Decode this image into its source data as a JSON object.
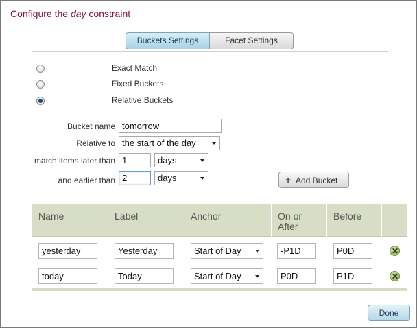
{
  "dialog": {
    "title_prefix": "Configure the ",
    "title_emph": "day",
    "title_suffix": " constraint"
  },
  "tabs": [
    {
      "label": "Buckets Settings",
      "active": true
    },
    {
      "label": "Facet Settings",
      "active": false
    }
  ],
  "match_options": [
    {
      "label": "Exact Match",
      "checked": false
    },
    {
      "label": "Fixed Buckets",
      "checked": false
    },
    {
      "label": "Relative Buckets",
      "checked": true
    }
  ],
  "bucket_form": {
    "name_label": "Bucket name",
    "name_value": "tomorrow",
    "relative_label": "Relative to",
    "relative_value": "the start of the day",
    "later_label": "match items later than",
    "later_value": "1",
    "later_unit": "days",
    "earlier_label": "and earlier than",
    "earlier_value": "2",
    "earlier_unit": "days",
    "add_button": "Add Bucket",
    "add_icon": "plus-icon"
  },
  "table": {
    "columns": [
      "Name",
      "Label",
      "Anchor",
      "On or After",
      "Before"
    ],
    "rows": [
      {
        "name": "yesterday",
        "label": "Yesterday",
        "anchor": "Start of Day",
        "on_or_after": "-P1D",
        "before": "P0D"
      },
      {
        "name": "today",
        "label": "Today",
        "anchor": "Start of Day",
        "on_or_after": "P0D",
        "before": "P1D"
      }
    ],
    "delete_icon": "delete-icon"
  },
  "footer": {
    "done_label": "Done"
  },
  "colors": {
    "title": "#8b1042",
    "table_header": "#d8ddc6",
    "active_tab": "#a9d2e4"
  }
}
